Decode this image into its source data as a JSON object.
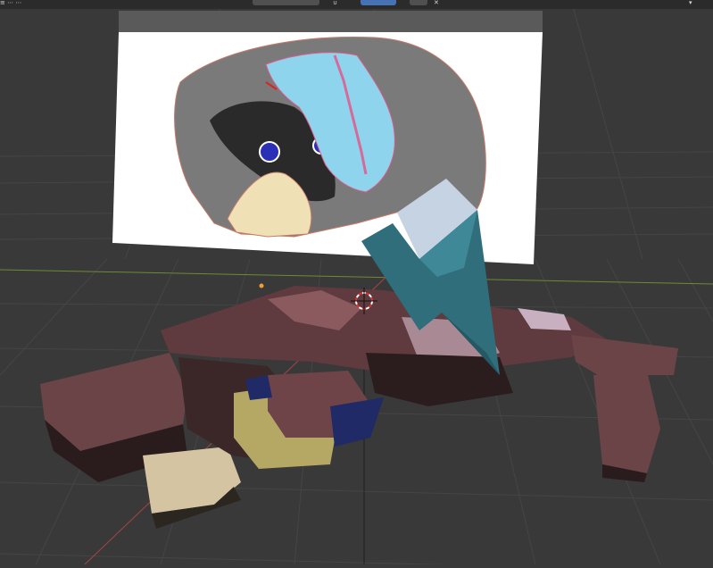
{
  "app": {
    "name": "3D Viewport",
    "colors": {
      "background": "#393939",
      "grid": "#444444",
      "axis_x": "#b34545",
      "axis_y": "#7d9c35",
      "active_button": "#4772b3"
    }
  },
  "header": {
    "icons": [
      "menu-icon",
      "pivot-icon",
      "snap-icon",
      "proportional-icon",
      "viewport-shading-icon",
      "overlay-icon",
      "close-icon"
    ]
  },
  "scene": {
    "objects": [
      {
        "name": "reference-image-plane",
        "icon": "image-icon"
      },
      {
        "name": "model-mesh",
        "colors": {
          "fur": "#5e3b3e",
          "belly": "#c5b575",
          "eye": "#283a80",
          "paw": "#d9c9a8"
        }
      },
      {
        "name": "annotation-shard",
        "colors": {
          "main": "#2f6e7a",
          "highlight": "#c5d3e3"
        }
      },
      {
        "name": "3d-cursor",
        "icon": "crosshair-icon"
      },
      {
        "name": "origin-point",
        "icon": "dot-icon"
      }
    ]
  }
}
